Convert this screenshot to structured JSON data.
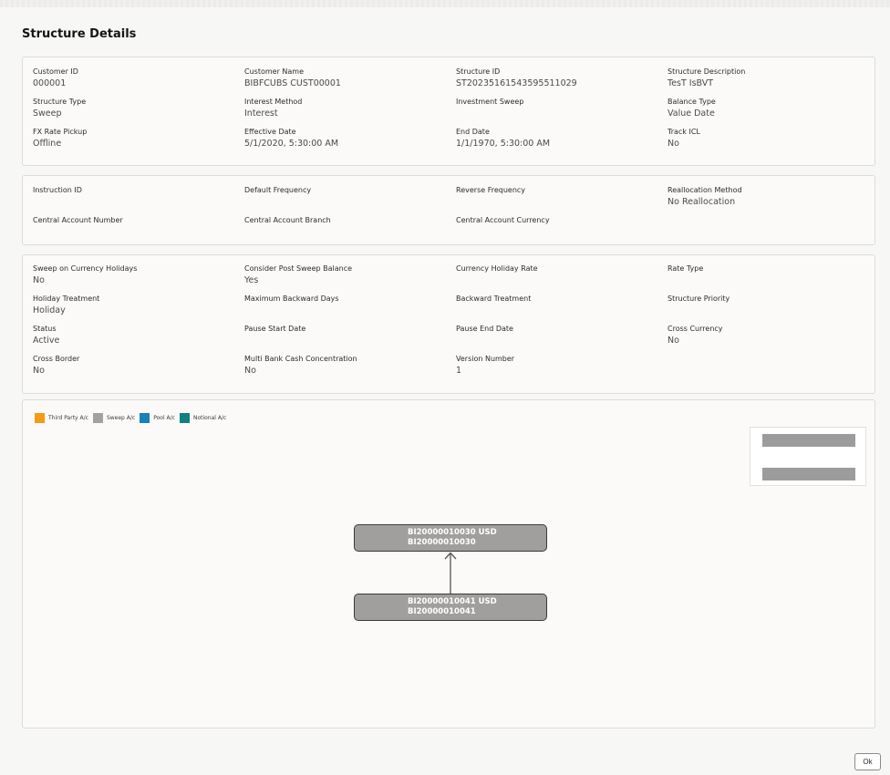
{
  "page": {
    "title": "Structure Details"
  },
  "sections": {
    "header": [
      {
        "label": "Customer ID",
        "value": "000001"
      },
      {
        "label": "Customer Name",
        "value": "BIBFCUBS CUST00001"
      },
      {
        "label": "Structure ID",
        "value": "ST20235161543595511029"
      },
      {
        "label": "Structure Description",
        "value": "TesT IsBVT"
      },
      {
        "label": "Structure Type",
        "value": "Sweep"
      },
      {
        "label": "Interest Method",
        "value": "Interest"
      },
      {
        "label": "Investment Sweep",
        "value": ""
      },
      {
        "label": "Balance Type",
        "value": "Value Date"
      },
      {
        "label": "FX Rate Pickup",
        "value": "Offline"
      },
      {
        "label": "Effective Date",
        "value": "5/1/2020, 5:30:00 AM"
      },
      {
        "label": "End Date",
        "value": "1/1/1970, 5:30:00 AM"
      },
      {
        "label": "Track ICL",
        "value": "No"
      }
    ],
    "instruction": [
      {
        "label": "Instruction ID",
        "value": ""
      },
      {
        "label": "Default Frequency",
        "value": ""
      },
      {
        "label": "Reverse Frequency",
        "value": ""
      },
      {
        "label": "Reallocation Method",
        "value": "No Reallocation"
      },
      {
        "label": "Central Account Number",
        "value": ""
      },
      {
        "label": "Central Account Branch",
        "value": ""
      },
      {
        "label": "Central Account Currency",
        "value": ""
      },
      {
        "label": "",
        "value": ""
      }
    ],
    "settings": [
      {
        "label": "Sweep on Currency Holidays",
        "value": "No"
      },
      {
        "label": "Consider Post Sweep Balance",
        "value": "Yes"
      },
      {
        "label": "Currency Holiday Rate",
        "value": ""
      },
      {
        "label": "Rate Type",
        "value": ""
      },
      {
        "label": "Holiday Treatment",
        "value": "Holiday"
      },
      {
        "label": "Maximum Backward Days",
        "value": ""
      },
      {
        "label": "Backward Treatment",
        "value": ""
      },
      {
        "label": "Structure Priority",
        "value": ""
      },
      {
        "label": "Status",
        "value": "Active"
      },
      {
        "label": "Pause Start Date",
        "value": ""
      },
      {
        "label": "Pause End Date",
        "value": ""
      },
      {
        "label": "Cross Currency",
        "value": "No"
      },
      {
        "label": "Cross Border",
        "value": "No"
      },
      {
        "label": "Multi Bank Cash Concentration",
        "value": "No"
      },
      {
        "label": "Version Number",
        "value": "1"
      },
      {
        "label": "",
        "value": ""
      }
    ]
  },
  "legend": [
    {
      "label": "Third Party A/c",
      "color": "#f59b16"
    },
    {
      "label": "Sweep A/c",
      "color": "#a3a2a1"
    },
    {
      "label": "Pool A/c",
      "color": "#1b81b8"
    },
    {
      "label": "Notional A/c",
      "color": "#127f80"
    }
  ],
  "nodes": {
    "parent": {
      "line1": "BI20000010030 USD",
      "line2": "BI20000010030"
    },
    "child": {
      "line1": "BI20000010041 USD",
      "line2": "BI20000010041"
    }
  },
  "colors": {
    "node_fill": "#a09f9e",
    "minimap_bar": "#9c9c9c"
  },
  "actions": {
    "ok_label": "Ok"
  }
}
